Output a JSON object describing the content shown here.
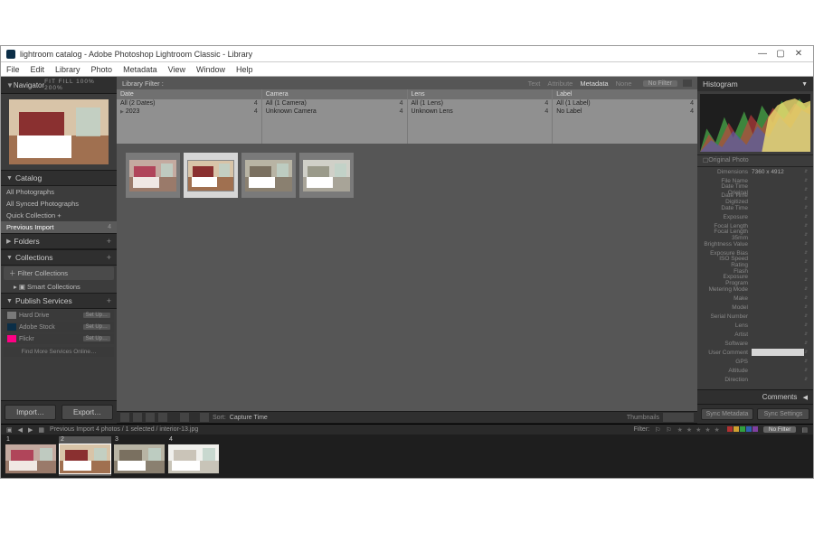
{
  "window": {
    "title": "lightroom catalog - Adobe Photoshop Lightroom Classic - Library",
    "minimize": "—",
    "maximize": "▢",
    "close": "✕"
  },
  "menu": [
    "File",
    "Edit",
    "Library",
    "Photo",
    "Metadata",
    "View",
    "Window",
    "Help"
  ],
  "left": {
    "navigator": {
      "title": "Navigator",
      "zoom": "FIT  FILL  100%  200%"
    },
    "catalog": {
      "title": "Catalog",
      "items": [
        {
          "label": "All Photographs"
        },
        {
          "label": "All Synced Photographs"
        },
        {
          "label": "Quick Collection  +"
        },
        {
          "label": "Previous Import",
          "count": "4",
          "selected": true
        }
      ]
    },
    "folders": {
      "title": "Folders"
    },
    "collections": {
      "title": "Collections",
      "items": [
        {
          "label": "Filter Collections",
          "filter": true
        },
        {
          "label": "Smart Collections",
          "sub": true
        }
      ]
    },
    "publish": {
      "title": "Publish Services",
      "items": [
        {
          "label": "Hard Drive",
          "set": "Set Up…",
          "color": "#7a7a7a"
        },
        {
          "label": "Adobe Stock",
          "set": "Set Up…",
          "color": "#0b2e47"
        },
        {
          "label": "Flickr",
          "set": "Set Up…",
          "color": "#ff0084"
        }
      ],
      "find_more": "Find More Services Online…"
    },
    "buttons": {
      "import": "Import…",
      "export": "Export…"
    }
  },
  "center": {
    "filter": {
      "title": "Library Filter :",
      "tabs": [
        "Text",
        "Attribute",
        "Metadata",
        "None"
      ],
      "active_tab": 2,
      "preset": "No Filter"
    },
    "meta_cols": [
      {
        "head": "Date",
        "rows": [
          {
            "label": "All (2 Dates)",
            "count": "4"
          },
          {
            "label": "2023",
            "count": "4",
            "tri": true
          }
        ]
      },
      {
        "head": "Camera",
        "rows": [
          {
            "label": "All (1 Camera)",
            "count": "4"
          },
          {
            "label": "Unknown Camera",
            "count": "4"
          }
        ]
      },
      {
        "head": "Lens",
        "rows": [
          {
            "label": "All (1 Lens)",
            "count": "4"
          },
          {
            "label": "Unknown Lens",
            "count": "4"
          }
        ]
      },
      {
        "head": "Label",
        "rows": [
          {
            "label": "All (1 Label)",
            "count": "4"
          },
          {
            "label": "No Label",
            "count": "4"
          }
        ]
      }
    ],
    "grid": [
      {
        "variant": "pink",
        "selected": false
      },
      {
        "variant": "warm",
        "selected": true
      },
      {
        "variant": "muted",
        "selected": false
      },
      {
        "variant": "cool",
        "selected": false
      }
    ],
    "toolbar": {
      "sort_label": "Sort:",
      "sort_value": "Capture Time",
      "right": "Thumbnails"
    }
  },
  "right": {
    "histogram": {
      "title": "Histogram",
      "info_left": "Original Photo",
      "dims": "7360 x 4912"
    },
    "meta": {
      "fields": [
        "File Name",
        "Date Time Original",
        "Date Time Digitized",
        "Date Time",
        "Exposure",
        "Focal Length",
        "Focal Length 35mm",
        "Brightness Value",
        "Exposure Bias",
        "ISO Speed Rating",
        "Flash",
        "Exposure Program",
        "Metering Mode",
        "Make",
        "Model",
        "Serial Number",
        "Lens",
        "Artist",
        "Software",
        "User Comment",
        "GPS",
        "Altitude",
        "Direction"
      ],
      "hilite_index": 19
    },
    "comments": "Comments",
    "buttons": {
      "reset": "Sync Metadata",
      "sync": "Sync Settings"
    }
  },
  "filmstrip": {
    "breadcrumb": "Previous Import    4 photos / 1 selected / interior-13.jpg",
    "filter_label": "Filter:",
    "stars": "★ ★ ★ ★ ★",
    "no_filter": "No Filter",
    "colors": [
      "#b03030",
      "#d0a030",
      "#30a040",
      "#3060b0",
      "#8040a0"
    ],
    "cells": [
      {
        "num": "1",
        "variant": "pink"
      },
      {
        "num": "2",
        "variant": "warm",
        "selected": true
      },
      {
        "num": "3",
        "variant": "muted"
      },
      {
        "num": "4",
        "variant": "bright"
      }
    ]
  }
}
